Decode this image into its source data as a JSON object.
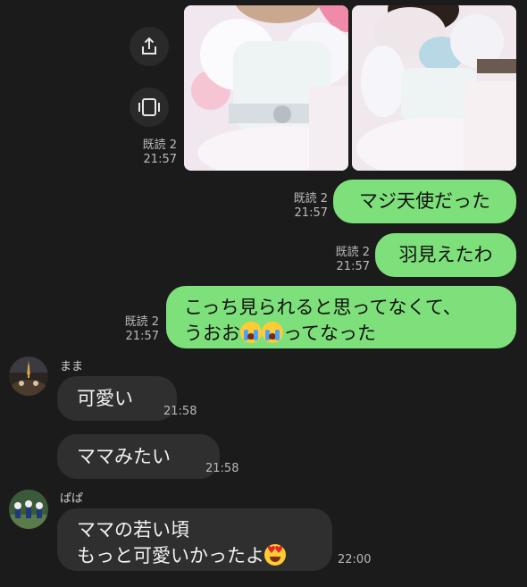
{
  "actions": {
    "share_icon": "share-icon",
    "multiscreen_icon": "screen-icon"
  },
  "messages": {
    "photos": {
      "read": "既読 2",
      "time": "21:57"
    },
    "m1": {
      "text": "マジ天使だった",
      "read": "既読 2",
      "time": "21:57"
    },
    "m2": {
      "text": "羽見えたわ",
      "read": "既読 2",
      "time": "21:57"
    },
    "m3": {
      "line1": "こっち見られると思ってなくて、",
      "line2_prefix": "うおお",
      "line2_suffix": "ってなった",
      "read": "既読 2",
      "time": "21:57"
    },
    "mama_name": "まま",
    "mama1": {
      "text": "可愛い",
      "time": "21:58"
    },
    "mama2": {
      "text": "ママみたい",
      "time": "21:58"
    },
    "papa_name": "ぱぱ",
    "papa1": {
      "line1": "ママの若い頃",
      "line2": "もっと可愛いかったよ",
      "time": "22:00"
    }
  },
  "colors": {
    "background": "#1b1b1b",
    "my_bubble": "#7ee07a",
    "their_bubble": "#2f2f2f"
  }
}
